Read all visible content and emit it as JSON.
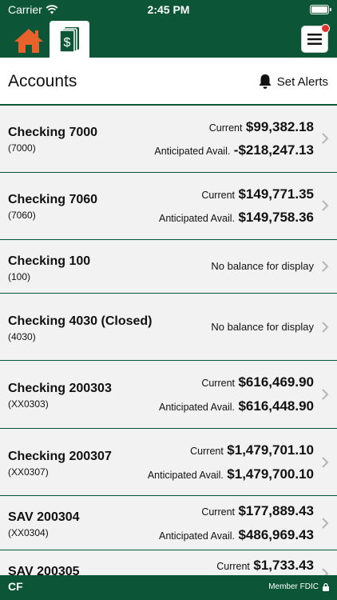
{
  "status_bar": {
    "carrier": "Carrier",
    "time": "2:45 PM"
  },
  "header": {
    "home_icon": "home-icon",
    "accounts_icon": "money-icon",
    "menu_icon": "hamburger-icon",
    "menu_badge_color": "#e0322b"
  },
  "page": {
    "title": "Accounts",
    "set_alerts_label": "Set Alerts"
  },
  "accounts": [
    {
      "name": "Checking 7000",
      "number": "(7000)",
      "current_label": "Current",
      "current": "$99,382.18",
      "anticipated_label": "Anticipated Avail.",
      "anticipated": "-$218,247.13"
    },
    {
      "name": "Checking 7060",
      "number": "(7060)",
      "current_label": "Current",
      "current": "$149,771.35",
      "anticipated_label": "Anticipated Avail.",
      "anticipated": "$149,758.36"
    },
    {
      "name": "Checking 100",
      "number": "(100)",
      "no_balance": "No balance for display"
    },
    {
      "name": "Checking 4030 (Closed)",
      "number": "(4030)",
      "no_balance": "No balance for display"
    },
    {
      "name": "Checking 200303",
      "number": "(XX0303)",
      "current_label": "Current",
      "current": "$616,469.90",
      "anticipated_label": "Anticipated Avail.",
      "anticipated": "$616,448.90"
    },
    {
      "name": "Checking 200307",
      "number": "(XX0307)",
      "current_label": "Current",
      "current": "$1,479,701.10",
      "anticipated_label": "Anticipated Avail.",
      "anticipated": "$1,479,700.10"
    },
    {
      "name": "SAV 200304",
      "number": "(XX0304)",
      "current_label": "Current",
      "current": "$177,889.43",
      "anticipated_label": "Anticipated Avail.",
      "anticipated": "$486,969.43"
    },
    {
      "name": "SAV 200305",
      "current_label": "Current",
      "current": "$1,733.43"
    }
  ],
  "footer": {
    "logo": "CF",
    "member_text": "Member FDIC"
  },
  "colors": {
    "brand_green": "#0c5637",
    "home_orange": "#e8622c",
    "row_bg": "#f2f2f2"
  }
}
